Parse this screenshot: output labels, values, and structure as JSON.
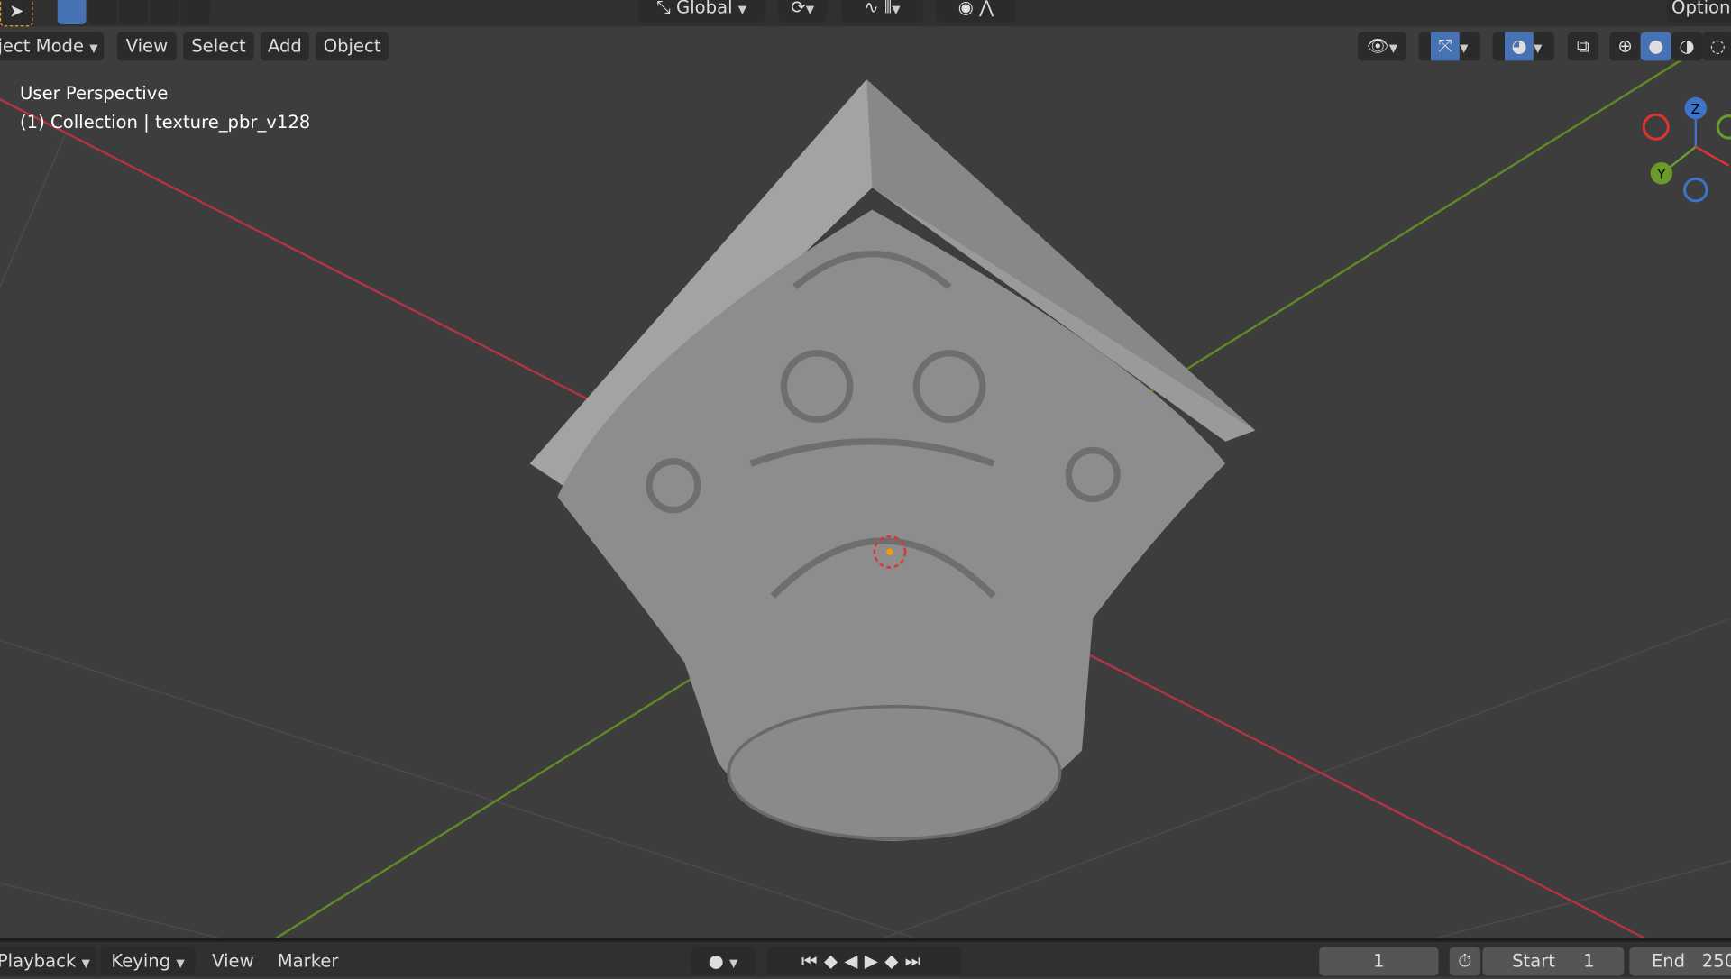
{
  "header": {
    "orientation": "Global",
    "options": "Options"
  },
  "menu": {
    "mode": "Object Mode",
    "view": "View",
    "select": "Select",
    "add": "Add",
    "object": "Object"
  },
  "viewport": {
    "perspective": "User Perspective",
    "collection": "(1) Collection | texture_pbr_v128"
  },
  "gizmo": {
    "z": "Z",
    "y": "Y"
  },
  "timeline": {
    "playback": "Playback",
    "keying": "Keying",
    "view": "View",
    "marker": "Marker",
    "current_frame": "1",
    "start_label": "Start",
    "start": "1",
    "end_label": "End",
    "end": "250"
  },
  "colors": {
    "accent": "#4772b3",
    "x_axis": "#c0394a",
    "y_axis": "#6a9a2a"
  }
}
